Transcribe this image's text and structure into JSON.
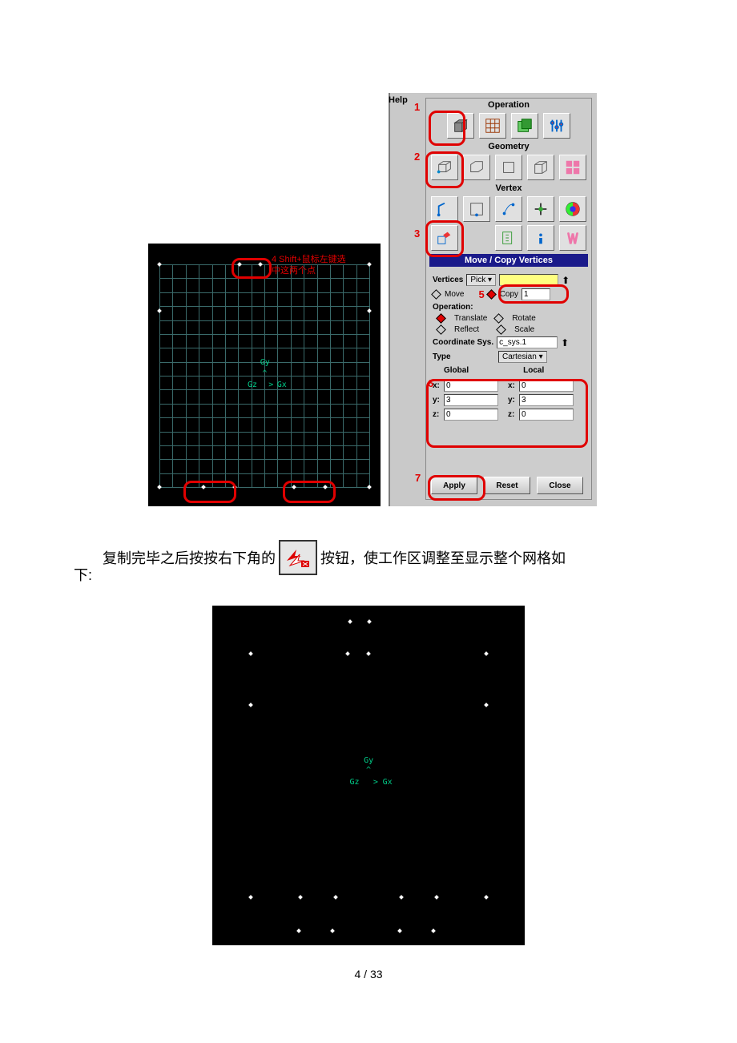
{
  "panel": {
    "help": "Help",
    "sections": {
      "operation": "Operation",
      "geometry": "Geometry",
      "vertex": "Vertex",
      "move_copy": "Move / Copy Vertices"
    },
    "form": {
      "vertices_label": "Vertices",
      "pick": "Pick",
      "move": "Move",
      "copy": "Copy",
      "copy_value": "1",
      "operation_label": "Operation:",
      "translate": "Translate",
      "rotate": "Rotate",
      "reflect": "Reflect",
      "scale": "Scale",
      "coordsys_label": "Coordinate Sys.",
      "coordsys_value": "c_sys.1",
      "type_label": "Type",
      "type_value": "Cartesian",
      "global": "Global",
      "local": "Local",
      "g": {
        "x": "0",
        "y": "3",
        "z": "0"
      },
      "l": {
        "x": "0",
        "y": "3",
        "z": "0"
      }
    },
    "buttons": {
      "apply": "Apply",
      "reset": "Reset",
      "close": "Close"
    }
  },
  "annotations": {
    "n1": "1",
    "n2": "2",
    "n3": "3",
    "n4": "4 Shift+鼠标左键选",
    "n4b": "中这两个点",
    "n5": "5",
    "n6": "6",
    "n7": "7",
    "axis_gy": "Gy",
    "axis_gx": "Gx",
    "axis_gz": "Gz"
  },
  "body_text": {
    "line1a": "复制完毕之后按按右下角的",
    "line1b": "按钮，使工作区调整至显示整个网格如",
    "line2": "下:"
  },
  "page_number": "4 / 33"
}
